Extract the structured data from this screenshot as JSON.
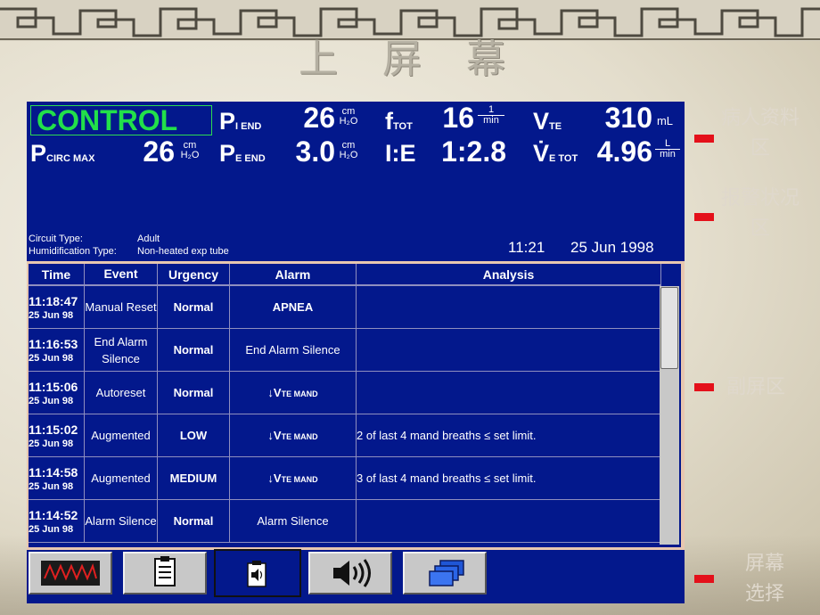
{
  "slide": {
    "title": "上 屏 幕"
  },
  "vitals": {
    "mode": "CONTROL",
    "pcirc_label": "P",
    "pcirc_sub": "CIRC MAX",
    "pcirc_value": "26",
    "piend_label": "P",
    "piend_sub": "I END",
    "piend_value": "26",
    "peend_label": "P",
    "peend_sub": "E END",
    "peend_value": "3.0",
    "ftot_label": "f",
    "ftot_sub": "TOT",
    "ftot_value": "16",
    "ie_label": "I:E",
    "ie_value": "1:2.8",
    "vte_label": "V",
    "vte_sub": "TE",
    "vte_value": "310",
    "vte_unit": "mL",
    "vetot_label": "V̇",
    "vetot_sub": "E TOT",
    "vetot_value": "4.96",
    "unit_cm": "cm",
    "unit_h2o": "H₂O",
    "unit_one": "1",
    "unit_min": "min",
    "unit_L": "L"
  },
  "alarm_area": {
    "circuit_label": "Circuit Type:",
    "circuit_value": "Adult",
    "humid_label": "Humidification Type:",
    "humid_value": "Non-heated exp tube",
    "time": "11:21",
    "date": "25 Jun 1998"
  },
  "log": {
    "headers": [
      "Time",
      "Event",
      "Urgency",
      "Alarm",
      "Analysis"
    ],
    "rows": [
      {
        "time": "11:18:47",
        "date": "25 Jun 98",
        "event": "Manual Reset",
        "urgency": "Normal",
        "alarm": "APNEA",
        "analysis": ""
      },
      {
        "time": "11:16:53",
        "date": "25 Jun 98",
        "event": "End Alarm Silence",
        "urgency": "Normal",
        "alarm": "End Alarm Silence",
        "analysis": ""
      },
      {
        "time": "11:15:06",
        "date": "25 Jun 98",
        "event": "Autoreset",
        "urgency": "Normal",
        "alarm": "↓V",
        "alarm_sub": "TE MAND",
        "analysis": ""
      },
      {
        "time": "11:15:02",
        "date": "25 Jun 98",
        "event": "Augmented",
        "urgency": "LOW",
        "alarm": "↓V",
        "alarm_sub": "TE MAND",
        "analysis": "2 of last 4 mand breaths ≤ set limit."
      },
      {
        "time": "11:14:58",
        "date": "25 Jun 98",
        "event": "Augmented",
        "urgency": "MEDIUM",
        "alarm": "↓V",
        "alarm_sub": "TE MAND",
        "analysis": "3 of last 4 mand breaths ≤ set limit."
      },
      {
        "time": "11:14:52",
        "date": "25 Jun 98",
        "event": "Alarm Silence",
        "urgency": "Normal",
        "alarm": "Alarm Silence",
        "analysis": ""
      }
    ]
  },
  "annotations": {
    "patient_area": "病人资料区",
    "alarm_area": "报警状况区",
    "sub_screen": "副屏区",
    "screen_select": "屏幕选择"
  },
  "colors": {
    "screen_blue": "#03188c",
    "mode_green": "#22e04a",
    "marker_red": "#e4101a"
  }
}
